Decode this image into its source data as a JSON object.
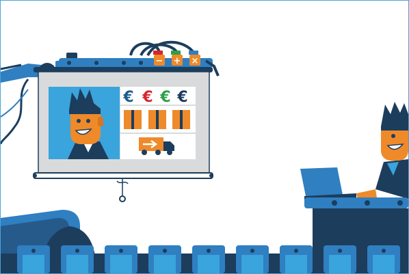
{
  "scene": {
    "euro_symbols": [
      {
        "text": "€",
        "color": "#1b5e8a"
      },
      {
        "text": "€",
        "color": "#d6262f"
      },
      {
        "text": "€",
        "color": "#2e9e4a"
      },
      {
        "text": "€",
        "color": "#1b3b5e"
      }
    ],
    "control_buttons": [
      {
        "symbol": "−",
        "color": "#ef8a2a"
      },
      {
        "symbol": "+",
        "color": "#ef8a2a"
      },
      {
        "symbol": "×",
        "color": "#ef8a2a"
      }
    ],
    "control_lamps": [
      "#d6262f",
      "#2e9e4a",
      "#2f7fc1"
    ],
    "boxes_count": 3,
    "conveyor_crates": 9,
    "colors": {
      "primary_blue": "#2f7fc1",
      "dark_navy": "#1d3d5c",
      "orange": "#ef8a2a",
      "light_blue_panel": "#3aa4dc",
      "screen_gray": "#d9dadb"
    },
    "icons": [
      "robot-arm-icon",
      "person-icon",
      "euro-icon",
      "box-icon",
      "delivery-truck-icon",
      "laptop-icon",
      "conveyor-belt-icon"
    ]
  }
}
